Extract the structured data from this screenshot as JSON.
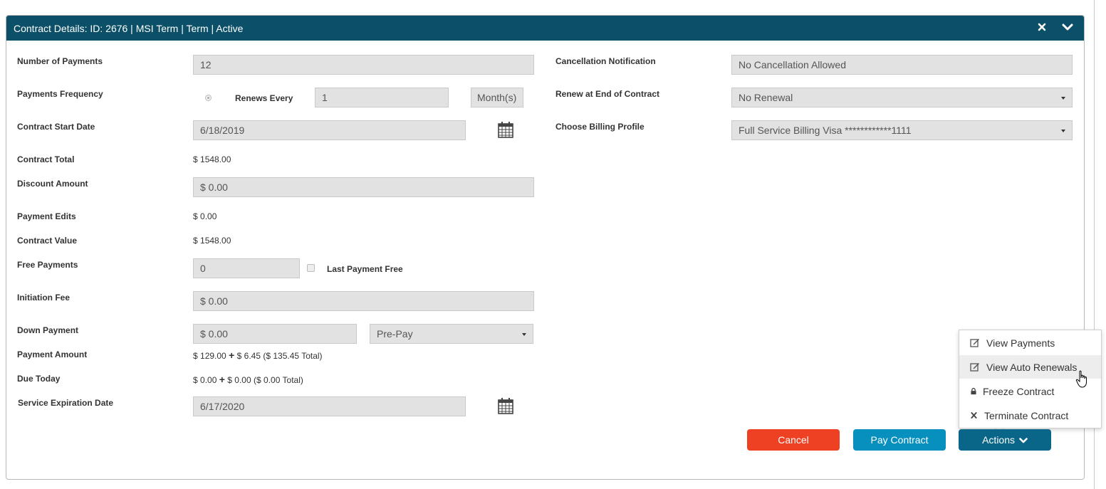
{
  "panel": {
    "title": "Contract Details: ID: 2676 | MSI Term | Term | Active"
  },
  "left": {
    "number_of_payments": {
      "label": "Number of Payments",
      "value": "12"
    },
    "payments_frequency": {
      "label": "Payments Frequency",
      "renews_label": "Renews Every",
      "value": "1",
      "unit": "Month(s)"
    },
    "contract_start_date": {
      "label": "Contract Start Date",
      "value": "6/18/2019"
    },
    "contract_total": {
      "label": "Contract Total",
      "currency": "$",
      "value": "1548.00"
    },
    "discount_amount": {
      "label": "Discount Amount",
      "value": "$  0.00"
    },
    "payment_edits": {
      "label": "Payment Edits",
      "currency": "$",
      "value": "0.00"
    },
    "contract_value": {
      "label": "Contract Value",
      "currency": "$",
      "value": "1548.00"
    },
    "free_payments": {
      "label": "Free Payments",
      "value": "0",
      "checkbox_label": "Last Payment Free"
    },
    "initiation_fee": {
      "label": "Initiation Fee",
      "value": "$  0.00"
    },
    "down_payment": {
      "label": "Down Payment",
      "value": "$  0.00",
      "type_value": "Pre-Pay"
    },
    "payment_amount": {
      "label": "Payment Amount",
      "c1": "$",
      "v1": "129.00",
      "c2": "$",
      "v2": "6.45",
      "open": "(",
      "c3": "$",
      "v3": "135.45",
      "total": "Total)"
    },
    "due_today": {
      "label": "Due Today",
      "c1": "$",
      "v1": "0.00",
      "c2": "$",
      "v2": "0.00",
      "open": "(",
      "c3": "$",
      "v3": "0.00",
      "total": "Total)"
    },
    "service_expiration_date": {
      "label": "Service Expiration Date",
      "value": "6/17/2020"
    }
  },
  "right": {
    "cancellation_notification": {
      "label": "Cancellation Notification",
      "value": "No Cancellation Allowed"
    },
    "renew_at_end": {
      "label": "Renew at End of Contract",
      "value": "No Renewal"
    },
    "billing_profile": {
      "label": "Choose Billing Profile",
      "value": "Full Service Billing Visa ************1111"
    }
  },
  "buttons": {
    "cancel": "Cancel",
    "pay": "Pay Contract",
    "actions": "Actions"
  },
  "actions_menu": {
    "items": [
      {
        "label": "View Payments",
        "icon": "edit-icon"
      },
      {
        "label": "View Auto Renewals",
        "icon": "edit-icon"
      },
      {
        "label": "Freeze Contract",
        "icon": "lock-icon"
      },
      {
        "label": "Terminate Contract",
        "icon": "x-icon"
      }
    ]
  },
  "colors": {
    "header": "#0b5068",
    "cancel": "#ee4023",
    "pay": "#078fbe",
    "actions": "#0a6688"
  }
}
